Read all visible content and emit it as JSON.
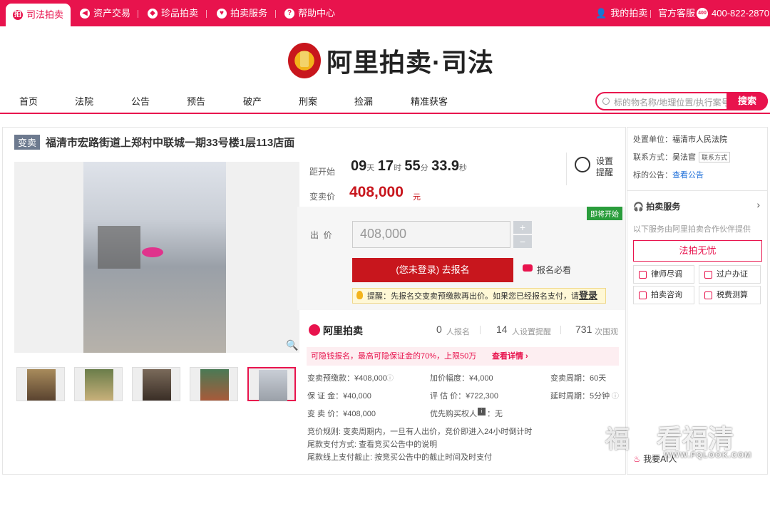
{
  "topbar": {
    "tabs": [
      "司法拍卖",
      "资产交易",
      "珍品拍卖",
      "拍卖服务",
      "帮助中心"
    ],
    "my_auction": "我的拍卖",
    "official_service": "官方客服",
    "phone": "400-822-2870"
  },
  "logo": {
    "text": "阿里拍卖·司法"
  },
  "nav": {
    "items": [
      "首页",
      "法院",
      "公告",
      "预告",
      "破产",
      "刑案",
      "捡漏",
      "精准获客"
    ]
  },
  "search": {
    "placeholder": "标的物名称/地理位置/执行案号",
    "button": "搜索"
  },
  "item": {
    "tag": "变卖",
    "title": "福清市宏路街道上郑村中联城一期33号楼1层113店面"
  },
  "timer": {
    "label": "距开始",
    "days": "09",
    "days_unit": "天",
    "hours": "17",
    "hours_unit": "时",
    "minutes": "55",
    "minutes_unit": "分",
    "seconds": "33.9",
    "seconds_unit": "秒",
    "reminder": "设置\n提醒"
  },
  "price": {
    "label": "变卖价",
    "value": "408,000",
    "unit": "元"
  },
  "bid": {
    "badge": "即将开始",
    "label": "出  价",
    "value": "408,000",
    "plus": "+",
    "minus": "−",
    "signup": "(您未登录) 去报名",
    "must_read": "报名必看",
    "tip": "提醒：先报名交变卖预缴款再出价。如果您已经报名支付，请",
    "tip_login": "登录"
  },
  "stats": {
    "brand": "阿里拍卖",
    "signups": "0",
    "signups_label": "人报名",
    "reminders": "14",
    "reminders_label": "人设置提醒",
    "views": "731",
    "views_label": "次围观"
  },
  "warning": {
    "text": "可隐钱报名，最高可隐保证金的70%，上限50万",
    "link": "查看详情 ›"
  },
  "details": {
    "deposit": "变卖预缴款：¥408,000",
    "increment": "加价幅度：¥4,000",
    "period": "变卖周期：60天",
    "guarantee": "保 证 金：¥40,000",
    "appraisal": "评 估 价：¥722,300",
    "delay": "延时周期：5分钟",
    "sale_price": "变 卖 价：¥408,000",
    "priority": "优先购买权人",
    "priority_value": "：无",
    "rule": "竞价规则:   变卖周期内，一旦有人出价，竞价即进入24小时倒计时",
    "payment": "尾款支付方式:   查看竞买公告中的说明",
    "deadline": "尾款线上支付截止:   按竞买公告中的截止时间及时支付"
  },
  "side": {
    "court_label": "处置单位：",
    "court": "福清市人民法院",
    "contact_label": "联系方式：",
    "contact": "吴法官",
    "contact_chip": "联系方式",
    "notice_label": "标的公告：",
    "notice_link": "查看公告",
    "service_title": "拍卖服务",
    "service_desc": "以下服务由阿里拍卖合作伙伴提供",
    "legal_btn": "法拍无忧",
    "lawyer": "律师尽调",
    "transfer": "过户办证",
    "consult": "拍卖咨询",
    "tax": "税费测算",
    "bottom": "我要AI",
    "bottom_more": "人"
  },
  "watermark": {
    "text": "看福清",
    "url": "WWW.FQLOOK.COM"
  },
  "colors": {
    "brand": "#e8134d",
    "price": "#c8161d",
    "badge": "#2a9d3c"
  }
}
